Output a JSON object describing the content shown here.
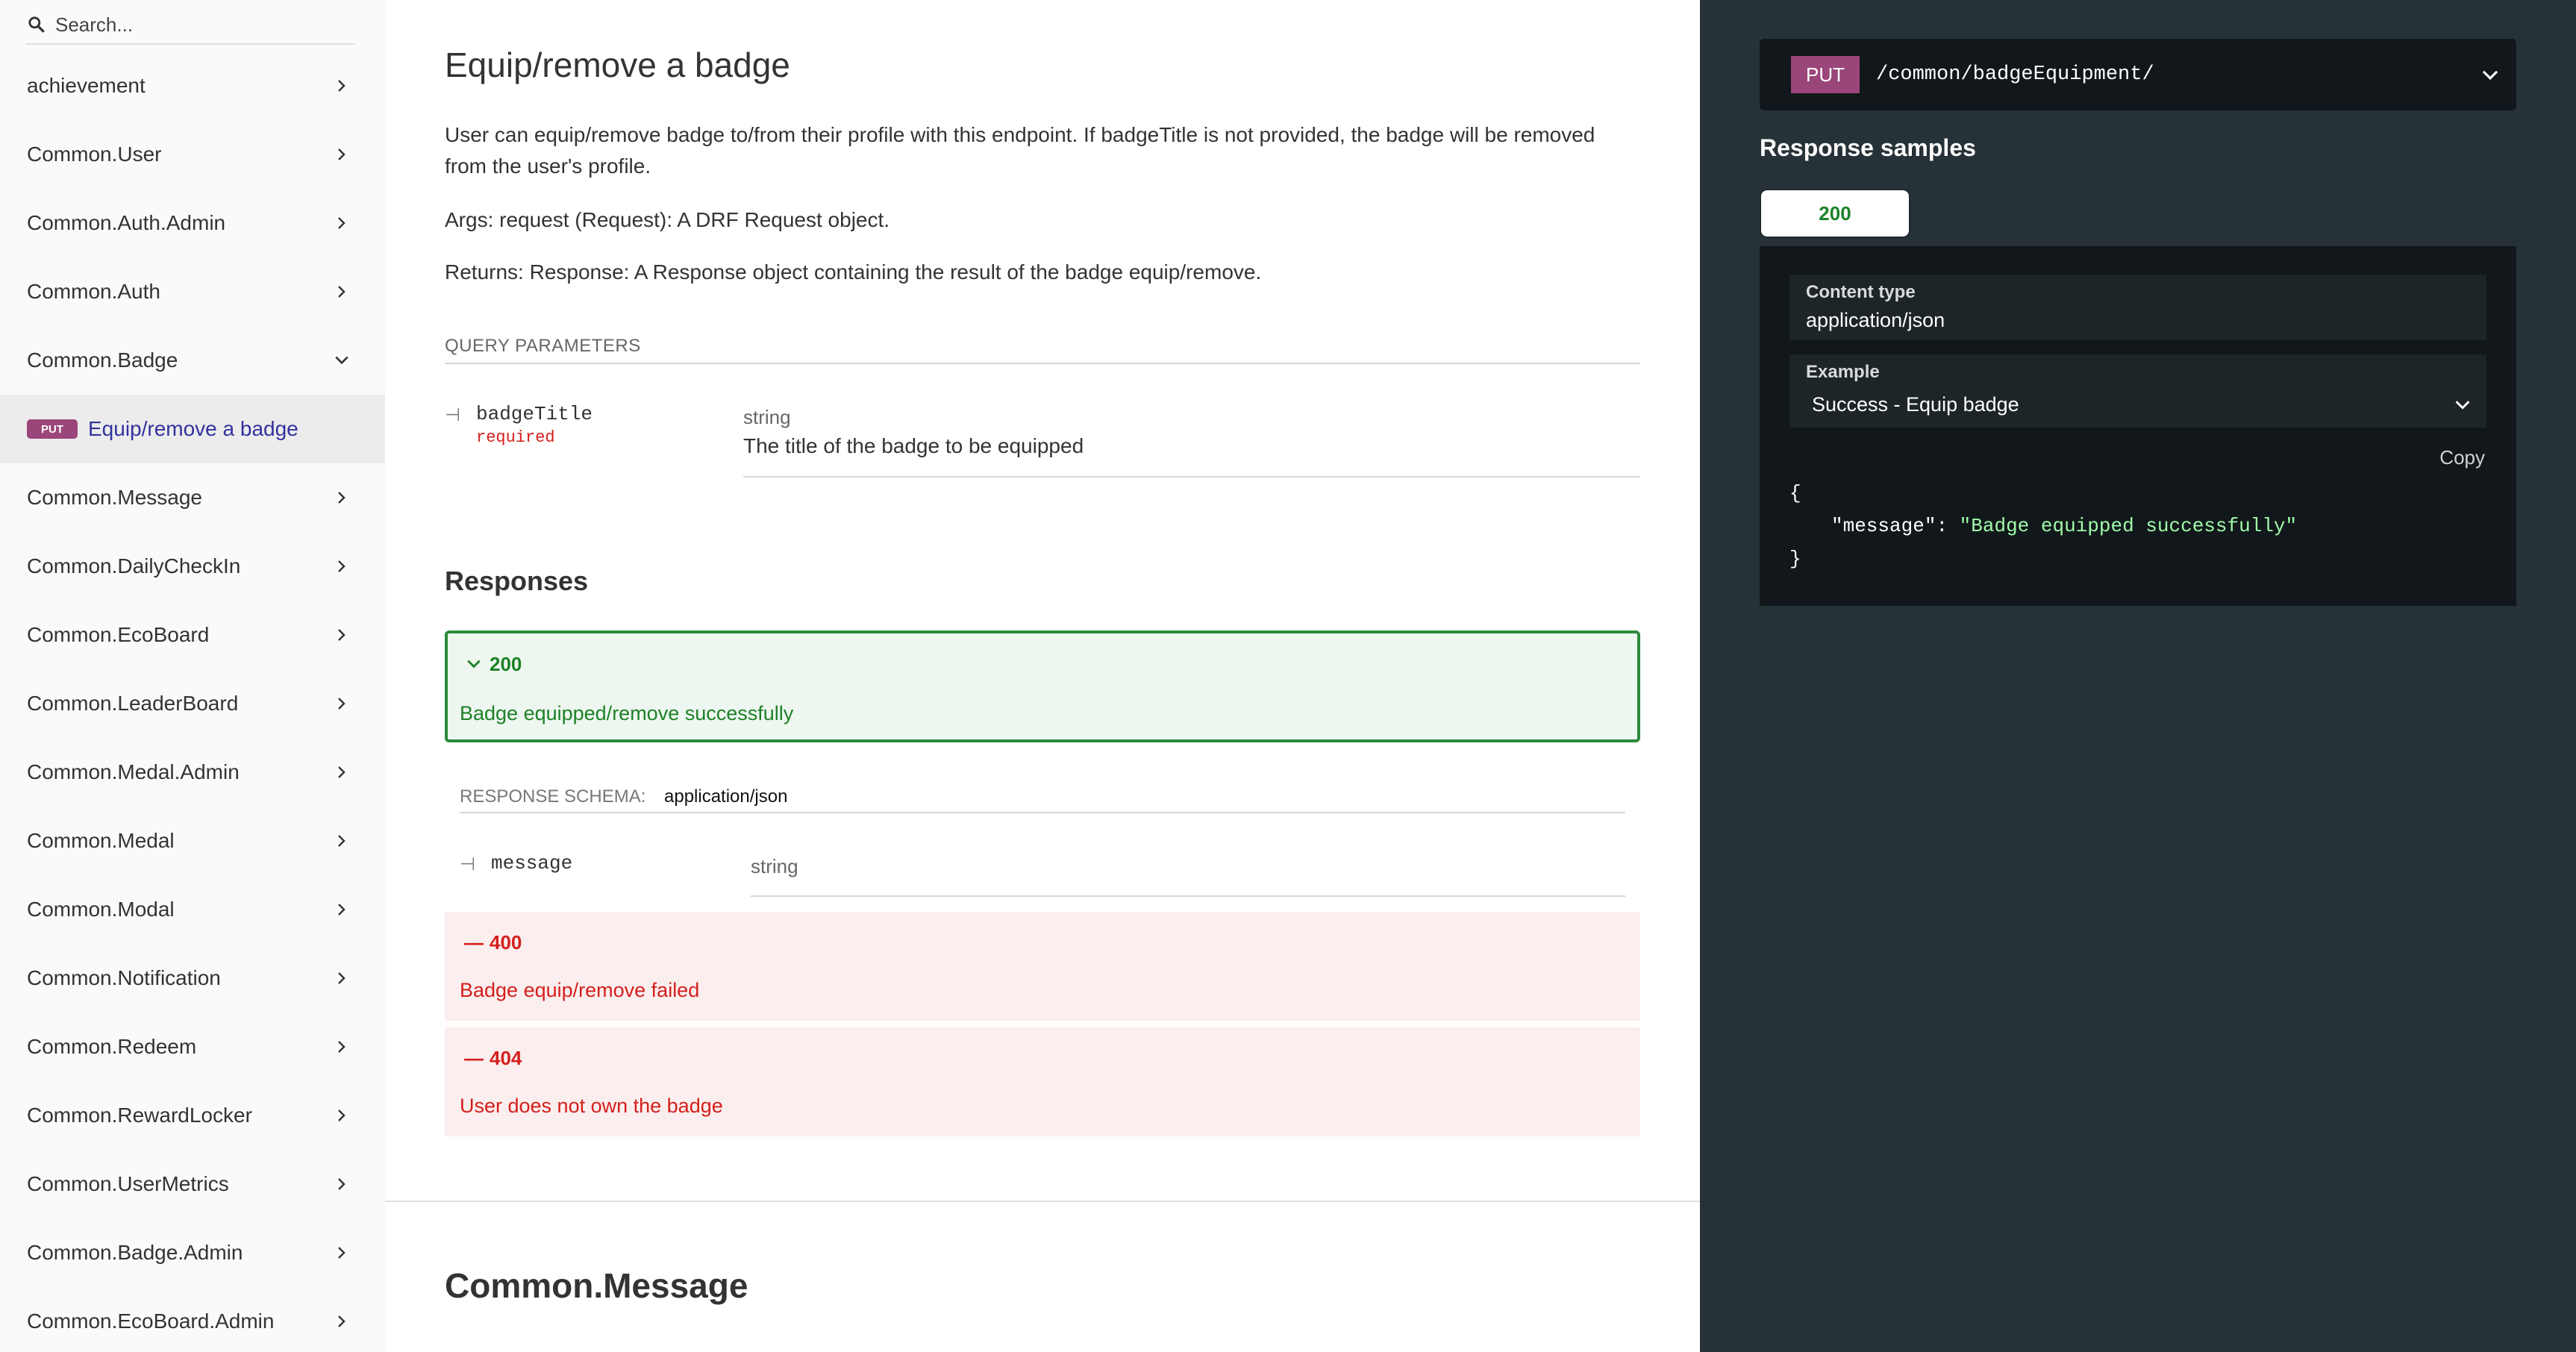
{
  "sidebar": {
    "search_placeholder": "Search...",
    "items": [
      {
        "label": "achievement",
        "expanded": false
      },
      {
        "label": "Common.User",
        "expanded": false
      },
      {
        "label": "Common.Auth.Admin",
        "expanded": false
      },
      {
        "label": "Common.Auth",
        "expanded": false
      },
      {
        "label": "Common.Badge",
        "expanded": true
      },
      {
        "label": "Common.Message",
        "expanded": false
      },
      {
        "label": "Common.DailyCheckIn",
        "expanded": false
      },
      {
        "label": "Common.EcoBoard",
        "expanded": false
      },
      {
        "label": "Common.LeaderBoard",
        "expanded": false
      },
      {
        "label": "Common.Medal.Admin",
        "expanded": false
      },
      {
        "label": "Common.Medal",
        "expanded": false
      },
      {
        "label": "Common.Modal",
        "expanded": false
      },
      {
        "label": "Common.Notification",
        "expanded": false
      },
      {
        "label": "Common.Redeem",
        "expanded": false
      },
      {
        "label": "Common.RewardLocker",
        "expanded": false
      },
      {
        "label": "Common.UserMetrics",
        "expanded": false
      },
      {
        "label": "Common.Badge.Admin",
        "expanded": false
      },
      {
        "label": "Common.EcoBoard.Admin",
        "expanded": false
      }
    ],
    "sub_item": {
      "method": "PUT",
      "label": "Equip/remove a badge"
    }
  },
  "main": {
    "title": "Equip/remove a badge",
    "description": "User can equip/remove badge to/from their profile with this endpoint. If badgeTitle is not provided, the badge will be removed from the user's profile.",
    "args": "Args: request (Request): A DRF Request object.",
    "returns": "Returns: Response: A Response object containing the result of the badge equip/remove.",
    "query_params_label": "QUERY PARAMETERS",
    "param": {
      "name": "badgeTitle",
      "required": "required",
      "type": "string",
      "description": "The title of the badge to be equipped"
    },
    "responses_title": "Responses",
    "responses": [
      {
        "code": "200",
        "text": "Badge equipped/remove successfully"
      },
      {
        "code": "400",
        "text": "Badge equip/remove failed"
      },
      {
        "code": "404",
        "text": "User does not own the badge"
      }
    ],
    "schema_label": "RESPONSE SCHEMA:",
    "schema_value": "application/json",
    "schema_field": {
      "name": "message",
      "type": "string"
    },
    "next_section": "Common.Message"
  },
  "right": {
    "method": "PUT",
    "path": "/common/badgeEquipment/",
    "samples_title": "Response samples",
    "tab": "200",
    "content_type_label": "Content type",
    "content_type_value": "application/json",
    "example_label": "Example",
    "example_value": "Success - Equip badge",
    "copy_label": "Copy",
    "code_open": "{",
    "code_key": "\"message\"",
    "code_colon": ": ",
    "code_value": "\"Badge equipped successfully\"",
    "code_close": "}"
  },
  "colors": {
    "put_badge": "#9b467a",
    "success_green": "#2b8a3a",
    "error_red": "#d41f1c",
    "right_panel": "#263238",
    "link_blue": "#32329f"
  },
  "icons": {
    "search": "search-icon",
    "chevron_right": "chevron-right-icon",
    "chevron_down": "chevron-down-icon"
  }
}
